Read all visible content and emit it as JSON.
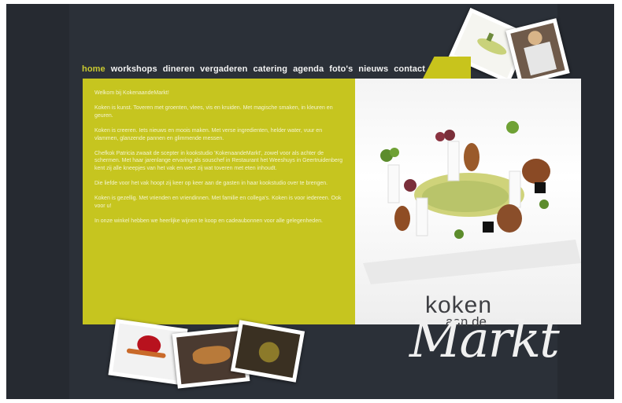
{
  "nav": {
    "items": [
      {
        "label": "home",
        "active": true
      },
      {
        "label": "workshops",
        "active": false
      },
      {
        "label": "dineren",
        "active": false
      },
      {
        "label": "vergaderen",
        "active": false
      },
      {
        "label": "catering",
        "active": false
      },
      {
        "label": "agenda",
        "active": false
      },
      {
        "label": "foto's",
        "active": false
      },
      {
        "label": "nieuws",
        "active": false
      },
      {
        "label": "contact",
        "active": false
      }
    ]
  },
  "content": {
    "paragraphs": [
      "Welkom bij KokenaandeMarkt!",
      "Koken is kunst. Toveren met groenten, vlees, vis en kruiden. Met magische smaken, in kleuren en geuren.",
      "Koken is creeren. Iets nieuws en moois maken. Met verse ingredienten, helder water, vuur en vlammen, glanzende pannen en glimmende messen.",
      "Chefkok Patricia zwaait de scepter in kookstudio 'KokenaandeMarkt', zowel voor als achter de schermen. Met haar jarenlange ervaring als souschef in Restaurant het Weeshuys in Geertruidenberg kent zij alle kneepjes van het vak en weet zij wat toveren met eten inhoudt.",
      "Die liefde voor het vak hoopt zij keer op keer aan de gasten in haar kookstudio over te brengen.",
      "Koken is gezellig. Met vrienden en vriendinnen. Met familie en collega's. Koken is voor iedereen. Ook voor u!",
      "In onze winkel hebben we heerlijke wijnen te koop en cadeaubonnen voor alle gelegenheden."
    ]
  },
  "logo": {
    "line1": "koken",
    "line2": "aan de",
    "line3": "Markt"
  },
  "colors": {
    "accent": "#c6c51f",
    "background": "#262a31",
    "nav_active": "#c9c930"
  }
}
